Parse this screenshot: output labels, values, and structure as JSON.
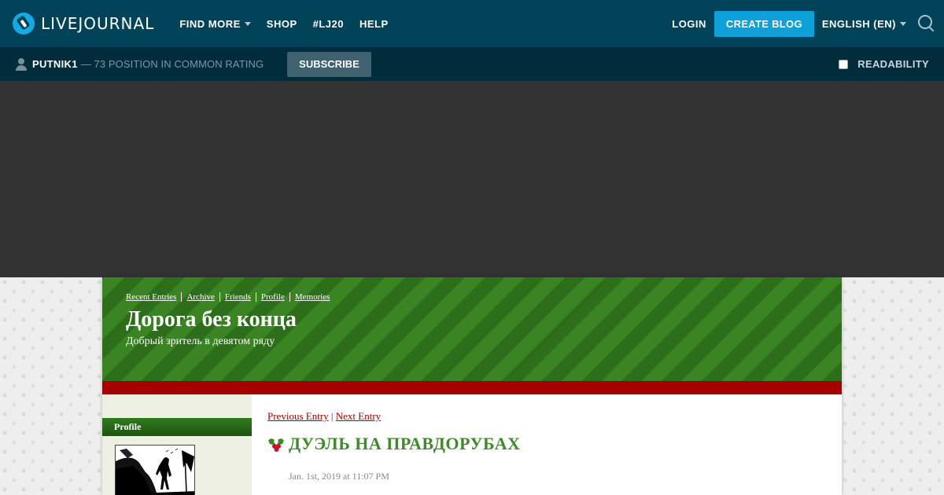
{
  "topbar": {
    "logo_text": "LIVEJOURNAL",
    "nav": [
      {
        "label": "FIND MORE",
        "has_dropdown": true
      },
      {
        "label": "SHOP",
        "has_dropdown": false
      },
      {
        "label": "#LJ20",
        "has_dropdown": false
      },
      {
        "label": "HELP",
        "has_dropdown": false
      }
    ],
    "login_label": "LOGIN",
    "create_blog_label": "CREATE BLOG",
    "language_label": "ENGLISH (EN)",
    "search_icon": "search-icon"
  },
  "userbar": {
    "user_icon": "user-icon",
    "username": "PUTNIK1",
    "rating_text": "— 73 POSITION IN COMMON RATING",
    "subscribe_label": "SUBSCRIBE",
    "readability_label": "READABILITY",
    "readability_checked": false
  },
  "journal": {
    "header_links": [
      "Recent Entries",
      "Archive",
      "Friends",
      "Profile",
      "Memories"
    ],
    "title": "Дорога без конца",
    "subtitle": "Добрый зритель в девятом ряду",
    "sidebar": {
      "profile_heading": "Profile"
    },
    "entry": {
      "prev_label": "Previous Entry",
      "separator": "|",
      "next_label": "Next Entry",
      "title": "ДУЭЛЬ НА ПРАВДОРУБАХ",
      "date": "Jan. 1st, 2019 at 11:07 PM"
    }
  },
  "colors": {
    "topbar": "#004359",
    "userbar": "#002c3c",
    "accent": "#0ea1d9",
    "header_green": "#2d6e1a",
    "band_red": "#a40000",
    "title_green": "#3f8a2a",
    "link_red": "#a00000"
  }
}
